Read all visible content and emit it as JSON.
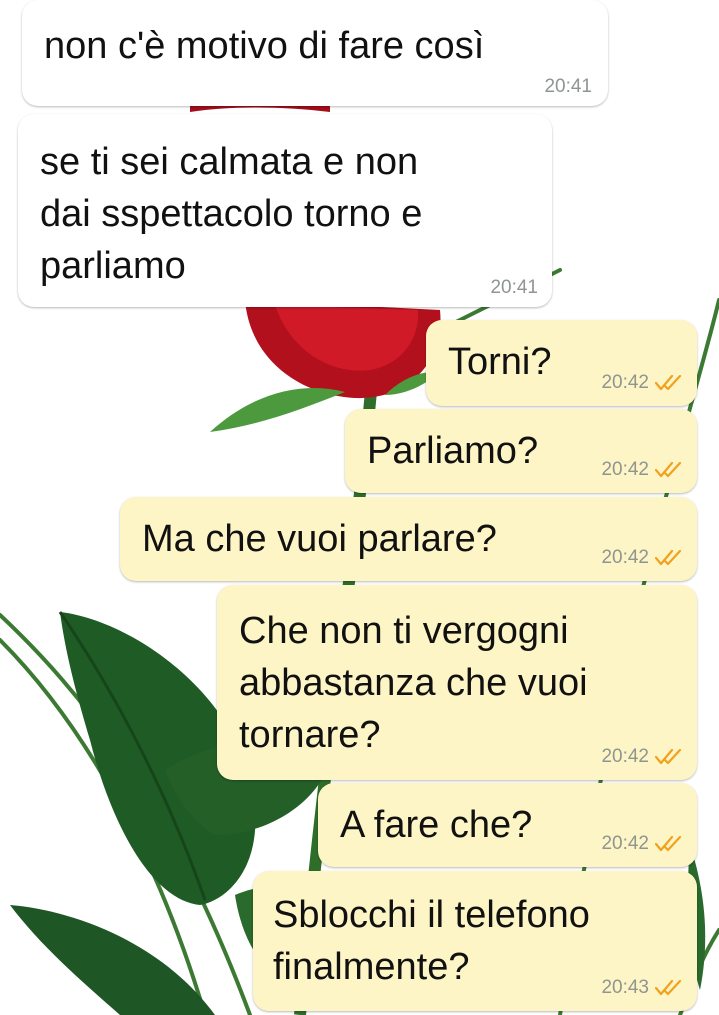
{
  "theme": {
    "incoming_bubble": "#ffffff",
    "outgoing_bubble": "#fdf5c5",
    "timestamp_color": "#8f9591",
    "read_tick_color": "#f0a21f",
    "wallpaper": "red-rose-on-white"
  },
  "messages": [
    {
      "direction": "incoming",
      "lines": [
        "non c'è motivo di fare così"
      ],
      "time": "20:41"
    },
    {
      "direction": "incoming",
      "lines": [
        "se ti sei calmata e non",
        "dai sspettacolo torno e",
        "parliamo"
      ],
      "time": "20:41"
    },
    {
      "direction": "outgoing",
      "lines": [
        "Torni?"
      ],
      "time": "20:42",
      "status_icon": "read-double-tick-icon"
    },
    {
      "direction": "outgoing",
      "lines": [
        "Parliamo?"
      ],
      "time": "20:42",
      "status_icon": "read-double-tick-icon"
    },
    {
      "direction": "outgoing",
      "lines": [
        "Ma che vuoi parlare?"
      ],
      "time": "20:42",
      "status_icon": "read-double-tick-icon"
    },
    {
      "direction": "outgoing",
      "lines": [
        "Che non ti vergogni",
        "abbastanza che vuoi",
        "tornare?"
      ],
      "time": "20:42",
      "status_icon": "read-double-tick-icon"
    },
    {
      "direction": "outgoing",
      "lines": [
        "A fare che?"
      ],
      "time": "20:42",
      "status_icon": "read-double-tick-icon"
    },
    {
      "direction": "outgoing",
      "lines": [
        "Sblocchi il telefono",
        "finalmente?"
      ],
      "time": "20:43",
      "status_icon": "read-double-tick-icon"
    }
  ]
}
